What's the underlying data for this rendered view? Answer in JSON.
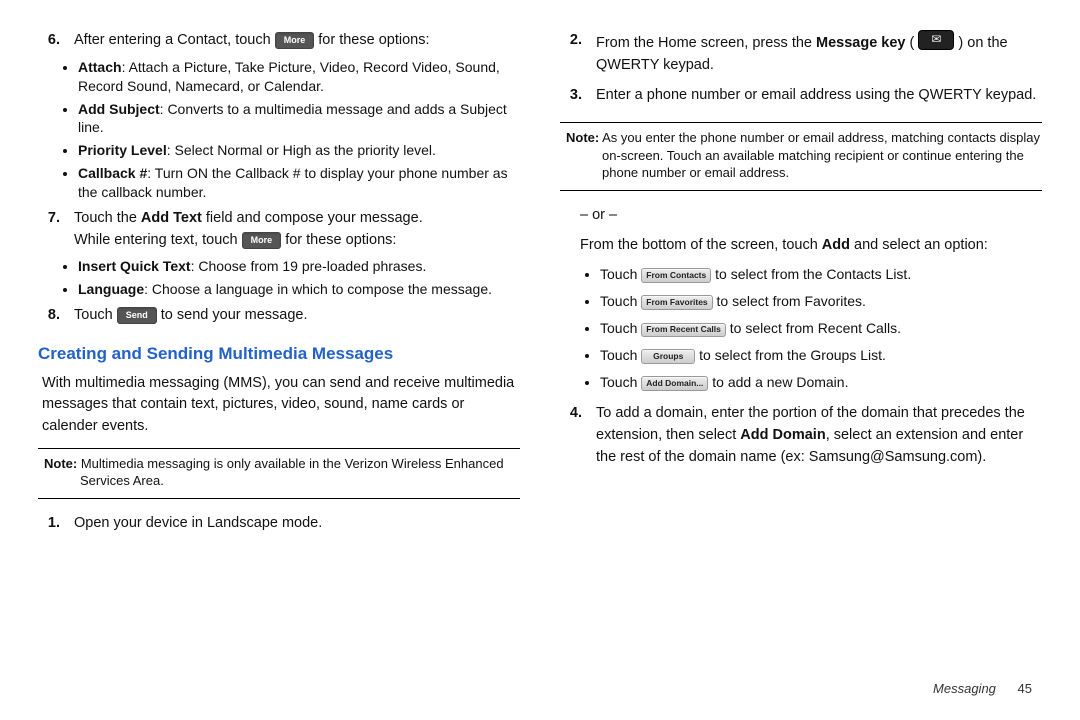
{
  "left": {
    "item6": {
      "num": "6.",
      "pre": "After entering a Contact, touch ",
      "btn": "More",
      "post": " for these options:",
      "bullets": [
        {
          "b": "Attach",
          "t": ": Attach a Picture, Take Picture, Video, Record Video, Sound, Record Sound, Namecard, or Calendar."
        },
        {
          "b": "Add Subject",
          "t": ": Converts to a multimedia message and adds a Subject line."
        },
        {
          "b": "Priority Level",
          "t": ": Select Normal or High as the priority level."
        },
        {
          "b": "Callback #",
          "t": ": Turn ON the Callback # to display your phone number as the callback number."
        }
      ]
    },
    "item7": {
      "num": "7.",
      "line1_pre": "Touch the ",
      "line1_b": "Add Text",
      "line1_post": " field and compose your message.",
      "line2_pre": "While entering text, touch ",
      "line2_btn": "More",
      "line2_post": " for these options:",
      "bullets": [
        {
          "b": "Insert Quick Text",
          "t": ": Choose from 19 pre-loaded phrases."
        },
        {
          "b": "Language",
          "t": ": Choose a language in which to compose the message."
        }
      ]
    },
    "item8": {
      "num": "8.",
      "pre": "Touch ",
      "btn": "Send",
      "post": " to send your message."
    },
    "section_title": "Creating and Sending Multimedia Messages",
    "section_para": "With multimedia messaging (MMS), you can send and receive multimedia messages that contain text, pictures, video, sound, name cards or calender events.",
    "note1_b": "Note:",
    "note1_t": " Multimedia messaging is only available in the Verizon Wireless Enhanced Services Area.",
    "item1": {
      "num": "1.",
      "t": "Open your device in Landscape mode."
    }
  },
  "right": {
    "item2": {
      "num": "2.",
      "pre": "From the Home screen, press the ",
      "b": "Message key",
      "post1": " ( ",
      "post2": " ) on the QWERTY keypad."
    },
    "item3": {
      "num": "3.",
      "t": "Enter a phone number or email address using the QWERTY keypad."
    },
    "note2_b": "Note:",
    "note2_t": " As you enter the phone number or email address, matching contacts display on-screen. Touch an available matching recipient or continue entering the phone number or email address.",
    "or": "– or –",
    "or_para_pre": "From the bottom of the screen, touch ",
    "or_para_b": "Add",
    "or_para_post": " and select an option:",
    "touch_bullets": [
      {
        "pre": "Touch ",
        "btn": "From Contacts",
        "post": " to select from the Contacts List."
      },
      {
        "pre": "Touch ",
        "btn": "From Favorites",
        "post": " to select from Favorites."
      },
      {
        "pre": "Touch ",
        "btn": "From Recent Calls",
        "post": " to select from Recent Calls."
      },
      {
        "pre": "Touch ",
        "btn": "Groups",
        "post": " to select from the Groups List."
      },
      {
        "pre": "Touch ",
        "btn": "Add Domain...",
        "post": " to add a new Domain."
      }
    ],
    "item4": {
      "num": "4.",
      "pre": "To add a domain, enter the portion of the domain that precedes the extension, then select ",
      "b": "Add Domain",
      "post": ", select an extension and enter the rest of the domain name (ex: Samsung@Samsung.com)."
    }
  },
  "footer": {
    "section": "Messaging",
    "page": "45"
  }
}
